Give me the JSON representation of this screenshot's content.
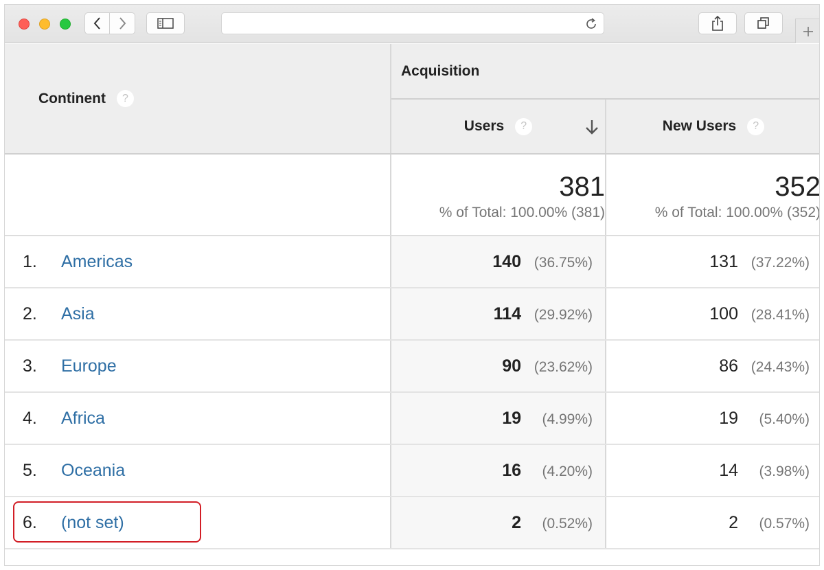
{
  "browser": {
    "address_value": "",
    "icons": {
      "back": "chevron-left-icon",
      "forward": "chevron-right-icon",
      "sidebar": "sidebar-icon",
      "reload": "reload-icon",
      "share": "share-icon",
      "tabs": "tab-overview-icon",
      "new_tab": "plus-icon"
    }
  },
  "table": {
    "dimension_header": "Continent",
    "group_header": "Acquisition",
    "help_glyph": "?",
    "columns": {
      "users": "Users",
      "new_users": "New Users"
    },
    "totals": {
      "users": {
        "value": "381",
        "sub": "% of Total: 100.00% (381)"
      },
      "new_users": {
        "value": "352",
        "sub": "% of Total: 100.00% (352)"
      }
    },
    "rows": [
      {
        "num": "1.",
        "name": "Americas",
        "users": "140",
        "users_pct": "(36.75%)",
        "new_users": "131",
        "new_users_pct": "(37.22%)"
      },
      {
        "num": "2.",
        "name": "Asia",
        "users": "114",
        "users_pct": "(29.92%)",
        "new_users": "100",
        "new_users_pct": "(28.41%)"
      },
      {
        "num": "3.",
        "name": "Europe",
        "users": "90",
        "users_pct": "(23.62%)",
        "new_users": "86",
        "new_users_pct": "(24.43%)"
      },
      {
        "num": "4.",
        "name": "Africa",
        "users": "19",
        "users_pct": "(4.99%)",
        "new_users": "19",
        "new_users_pct": "(5.40%)"
      },
      {
        "num": "5.",
        "name": "Oceania",
        "users": "16",
        "users_pct": "(4.20%)",
        "new_users": "14",
        "new_users_pct": "(3.98%)"
      },
      {
        "num": "6.",
        "name": "(not set)",
        "users": "2",
        "users_pct": "(0.52%)",
        "new_users": "2",
        "new_users_pct": "(0.57%)"
      }
    ],
    "highlighted_row": 6
  },
  "colors": {
    "link": "#2f6fa5",
    "highlight": "#d21e26",
    "header_bg": "#eeeeee"
  }
}
